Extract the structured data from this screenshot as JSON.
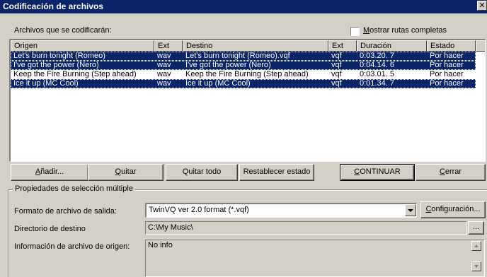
{
  "window": {
    "title": "Codificación de archivos",
    "close_glyph": "✕"
  },
  "files_label": "Archivos que se codificarán:",
  "show_paths": {
    "label": "Mostrar rutas completas",
    "checked": false
  },
  "table": {
    "columns": [
      "Origen",
      "Ext",
      "Destino",
      "Ext",
      "Duración",
      "Estado"
    ],
    "rows": [
      {
        "origen": "Let's burn tonight (Romeo)",
        "ext": "wav",
        "destino": "Let's burn tonight (Romeo).vqf",
        "ext2": "vqf",
        "duracion": "0:03.20. 7",
        "estado": "Por hacer",
        "selected": true
      },
      {
        "origen": "I've got the power (Nero)",
        "ext": "wav",
        "destino": "I've got the power (Nero)",
        "ext2": "vqf",
        "duracion": "0:04.14. 6",
        "estado": "Por hacer",
        "selected": true
      },
      {
        "origen": "Keep the Fire Burning (Step ahead)",
        "ext": "wav",
        "destino": "Keep the Fire Burning (Step ahead)",
        "ext2": "vqf",
        "duracion": "0:03.01. 5",
        "estado": "Por hacer",
        "selected": false
      },
      {
        "origen": "Ice it up (MC Cool)",
        "ext": "wav",
        "destino": "Ice it up (MC Cool)",
        "ext2": "vqf",
        "duracion": "0:01.34. 7",
        "estado": "Por hacer",
        "selected": true
      }
    ]
  },
  "buttons": {
    "add": "Añadir...",
    "remove": "Quitar",
    "remove_all": "Quitar todo",
    "reset": "Restablecer estado",
    "continue": "CONTINUAR",
    "close": "Cerrar"
  },
  "props": {
    "group_label": "Propiedades de selección múltiple",
    "format_label": "Formato de archivo de salida:",
    "format_value": "TwinVQ ver 2.0 format (*.vqf)",
    "config_button": "Configuración...",
    "dir_label": "Directorio de destino",
    "dir_value": "C:\\My Music\\",
    "browse_button": "...",
    "info_label": "Información de archivo de origen:",
    "info_value": "No info"
  },
  "colors": {
    "face": "#d4d0c8",
    "selection": "#0a246a",
    "title_bar": "#0a246a"
  }
}
